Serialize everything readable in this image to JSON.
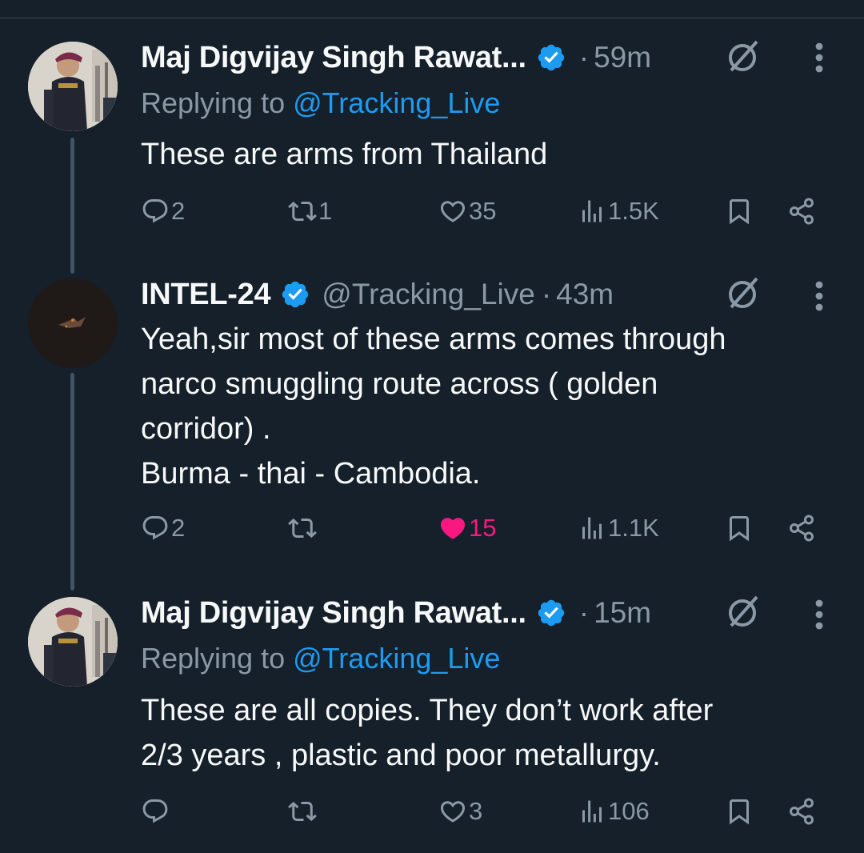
{
  "tweets": [
    {
      "name": "Maj Digvijay Singh Rawat...",
      "time": "59m",
      "replying_prefix": "Replying to ",
      "replying_handle": "@Tracking_Live",
      "text": "These are arms from Thailand",
      "stats": {
        "replies": "2",
        "reposts": "1",
        "likes": "35",
        "views": "1.5K",
        "liked": false
      }
    },
    {
      "name": "INTEL-24",
      "handle": "@Tracking_Live",
      "time": "43m",
      "text": "Yeah,sir most of these arms comes through\nnarco smuggling route across ( golden\ncorridor) .\nBurma - thai - Cambodia.",
      "stats": {
        "replies": "2",
        "reposts": "",
        "likes": "15",
        "views": "1.1K",
        "liked": true
      }
    },
    {
      "name": "Maj Digvijay Singh Rawat...",
      "time": "15m",
      "replying_prefix": "Replying to ",
      "replying_handle": "@Tracking_Live",
      "text": "These are all copies. They don’t work after\n2/3 years , plastic and poor metallurgy.",
      "stats": {
        "replies": "",
        "reposts": "",
        "likes": "3",
        "views": "106",
        "liked": false
      }
    }
  ],
  "separator": "·",
  "icons": {
    "verified": "verified-badge-icon",
    "grok": "grok-icon",
    "more": "more-options-icon",
    "reply": "reply-icon",
    "repost": "repost-icon",
    "like": "like-heart-icon",
    "views": "views-chart-icon",
    "bookmark": "bookmark-icon",
    "share": "share-icon"
  },
  "colors": {
    "background": "#15202b",
    "accent": "#1d9bf0",
    "like": "#f91880",
    "muted": "#8b98a5"
  }
}
